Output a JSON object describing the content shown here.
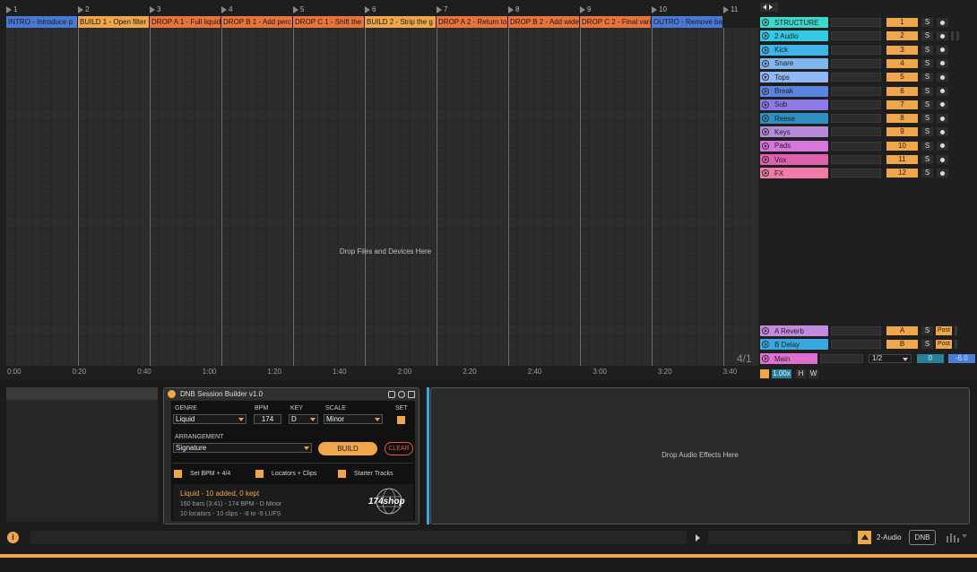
{
  "ruler": {
    "bars": [
      "1",
      "2",
      "3",
      "4",
      "5",
      "6",
      "7",
      "8",
      "9",
      "10",
      "11"
    ]
  },
  "locators": [
    {
      "label": "INTRO - Introduce p",
      "color": "#4a78d6"
    },
    {
      "label": "BUILD 1 - Open filter",
      "color": "#f0a64a"
    },
    {
      "label": "DROP A 1 - Full liquid",
      "color": "#e8743c"
    },
    {
      "label": "DROP B 1 - Add perc",
      "color": "#e8743c"
    },
    {
      "label": "DROP C 1 - Shift the",
      "color": "#e8743c"
    },
    {
      "label": "BUILD 2 - Strip the g",
      "color": "#f0a64a"
    },
    {
      "label": "DROP A 2 - Return to",
      "color": "#e8743c"
    },
    {
      "label": "DROP B 2 - Add wide",
      "color": "#e8743c"
    },
    {
      "label": "DROP C 2 - Final vari",
      "color": "#e8743c"
    },
    {
      "label": "OUTRO - Remove ba",
      "color": "#4a78d6"
    }
  ],
  "arrangement": {
    "drop_hint": "Drop Files and Devices Here",
    "time_signature": "4/1"
  },
  "timeline": [
    "0:00",
    "0:20",
    "0:40",
    "1:00",
    "1:20",
    "1:40",
    "2:00",
    "2:20",
    "2:40",
    "3:00",
    "3:20",
    "3:40"
  ],
  "tracks": [
    {
      "name": "STRUCTURE",
      "num": "1",
      "color": "#3cd8d0"
    },
    {
      "name": "2 Audio",
      "num": "2",
      "color": "#34c9e0",
      "rec": true
    },
    {
      "name": "Kick",
      "num": "3",
      "color": "#3eb4e8"
    },
    {
      "name": "Snare",
      "num": "4",
      "color": "#7fb6f0"
    },
    {
      "name": "Tops",
      "num": "5",
      "color": "#8fb8f4"
    },
    {
      "name": "Break",
      "num": "6",
      "color": "#5a86e0"
    },
    {
      "name": "Sub",
      "num": "7",
      "color": "#8c7ae8"
    },
    {
      "name": "Reese",
      "num": "8",
      "color": "#2f8fbf"
    },
    {
      "name": "Keys",
      "num": "9",
      "color": "#b58ad8"
    },
    {
      "name": "Pads",
      "num": "10",
      "color": "#d776e0"
    },
    {
      "name": "Vox",
      "num": "11",
      "color": "#e060b0"
    },
    {
      "name": "FX",
      "num": "12",
      "color": "#f07aa8"
    }
  ],
  "returns": [
    {
      "name": "A Reverb",
      "num": "A",
      "color": "#c38be0"
    },
    {
      "name": "B Delay",
      "num": "B",
      "color": "#3aa8e0"
    }
  ],
  "main": {
    "name": "Main",
    "color": "#e070d0",
    "quant": "1/2",
    "vol": "0",
    "pan": "-6.0",
    "tempo": "1.00x",
    "h": "H",
    "w": "W"
  },
  "device": {
    "title": "DNB Session Builder v1.0",
    "genre_label": "GENRE",
    "genre": "Liquid",
    "bpm_label": "BPM",
    "bpm": "174",
    "key_label": "KEY",
    "key": "D",
    "scale_label": "SCALE",
    "scale": "Minor",
    "set_label": "SET",
    "arr_label": "ARRANGEMENT",
    "arrangement": "Signature",
    "build": "BUILD",
    "clear": "CLEAR",
    "opt1": "Set BPM + 4/4",
    "opt2": "Locators + Clips",
    "opt3": "Starter Tracks",
    "status": "Liquid - 10 added, 0 kept",
    "info1": "160 bars (3:41) - 174 BPM - D Minor",
    "info2": "10 locators - 10 clips - -8 to -9 LUFS",
    "logo": "174shop"
  },
  "effects": {
    "drop_hint": "Drop Audio Effects Here"
  },
  "status": {
    "track": "2-Audio",
    "device_tab": "DNB Se"
  },
  "colors": {
    "accent": "#f0a64a"
  }
}
